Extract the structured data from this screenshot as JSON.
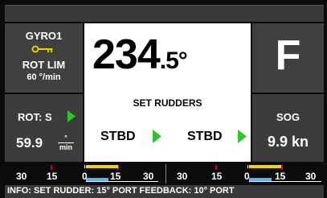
{
  "gyro": {
    "source": "GYRO1",
    "rot_lim_label": "ROT LIM",
    "rot_lim_value": "60 °/min",
    "key_icon": "key-icon"
  },
  "rot": {
    "label": "ROT: S",
    "value": "59.9",
    "unit_num": "°",
    "unit_den": "min"
  },
  "heading": {
    "integer": "234",
    "fraction": ".5°"
  },
  "center": {
    "instruction": "SET RUDDERS",
    "left_dir": "STBD",
    "right_dir": "STBD"
  },
  "mode": {
    "letter": "F"
  },
  "sog": {
    "label": "SOG",
    "value": "9.9 kn"
  },
  "scale": {
    "left": [
      "30",
      "15",
      "0",
      "15",
      "30"
    ],
    "right": [
      "30",
      "15",
      "0",
      "15",
      "30"
    ],
    "left_set_value": "15° PORT",
    "right_feedback_value": "10° PORT"
  },
  "info": {
    "text": "INFO:  SET RUDDER: 15° PORT   FEEDBACK: 10° PORT"
  },
  "colors": {
    "accent_green": "#2fc52f",
    "key_yellow": "#e8d000",
    "rudder_yellow": "#f5d400",
    "rudder_blue": "#5ab0ff",
    "tick_red": "#e00000"
  }
}
